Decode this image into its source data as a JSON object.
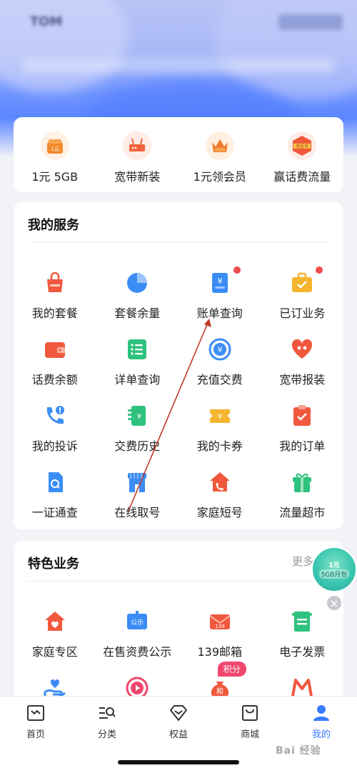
{
  "hero": {
    "title": "TOM"
  },
  "promo": [
    {
      "label": "1元 5GB",
      "icon": "gift-box-icon",
      "icon_text": "1元",
      "color": "#f28a2d",
      "bg": "#fff1e3"
    },
    {
      "label": "宽带新装",
      "icon": "router-icon",
      "icon_text": "",
      "color": "#f0633a",
      "bg": "#ffece4"
    },
    {
      "label": "1元领会员",
      "icon": "crown-icon",
      "icon_text": "特惠",
      "color": "#f27b2e",
      "bg": "#fff0e2"
    },
    {
      "label": "赢话费流量",
      "icon": "gold-badge-icon",
      "icon_text": "领金币",
      "color": "#f05a3a",
      "bg": "#ffece6"
    }
  ],
  "my_services": {
    "title": "我的服务",
    "items": [
      {
        "label": "我的套餐",
        "icon": "bag-icon",
        "color": "#f0593e",
        "dot": false
      },
      {
        "label": "套餐余量",
        "icon": "pie-chart-icon",
        "color": "#3b8df5",
        "dot": false
      },
      {
        "label": "账单查询",
        "icon": "bill-icon",
        "color": "#3b8df5",
        "dot": true
      },
      {
        "label": "已订业务",
        "icon": "briefcase-icon",
        "color": "#f5b52e",
        "dot": true
      },
      {
        "label": "话费余额",
        "icon": "wallet-icon",
        "color": "#f0593e",
        "dot": false
      },
      {
        "label": "详单查询",
        "icon": "list-icon",
        "color": "#2ec27e",
        "dot": false
      },
      {
        "label": "充值交费",
        "icon": "yuan-circle-icon",
        "color": "#3b8df5",
        "dot": false
      },
      {
        "label": "宽带报装",
        "icon": "heart-people-icon",
        "color": "#f0593e",
        "dot": false
      },
      {
        "label": "我的投诉",
        "icon": "phone-alert-icon",
        "color": "#3b8df5",
        "dot": false
      },
      {
        "label": "交费历史",
        "icon": "receipt-icon",
        "color": "#2ec27e",
        "dot": false
      },
      {
        "label": "我的卡券",
        "icon": "ticket-icon",
        "color": "#f5b52e",
        "dot": false
      },
      {
        "label": "我的订单",
        "icon": "clipboard-check-icon",
        "color": "#f0593e",
        "dot": false
      },
      {
        "label": "一证通查",
        "icon": "sim-card-icon",
        "color": "#3b8df5",
        "dot": false
      },
      {
        "label": "在线取号",
        "icon": "store-icon",
        "color": "#3b8df5",
        "dot": false
      },
      {
        "label": "家庭短号",
        "icon": "house-phone-icon",
        "color": "#f0593e",
        "dot": false
      },
      {
        "label": "流量超市",
        "icon": "gift-icon",
        "color": "#2ec27e",
        "dot": false
      }
    ]
  },
  "features": {
    "title": "特色业务",
    "more": "更多",
    "items": [
      {
        "label": "家庭专区",
        "icon": "home-heart-icon",
        "color": "#f0593e"
      },
      {
        "label": "在售资费公示",
        "icon": "notice-icon",
        "color": "#3b8df5",
        "icon_text": "公示"
      },
      {
        "label": "139邮箱",
        "icon": "mail-icon",
        "color": "#f0593e",
        "icon_text": "139"
      },
      {
        "label": "电子发票",
        "icon": "invoice-icon",
        "color": "#2ec27e"
      },
      {
        "label": "",
        "icon": "hand-heart-icon",
        "color": "#3b8df5"
      },
      {
        "label": "",
        "icon": "play-headset-icon",
        "color": "#f0476e"
      },
      {
        "label": "",
        "icon": "money-bag-icon",
        "color": "#f0593e",
        "icon_text": "和",
        "badge": "积分"
      },
      {
        "label": "",
        "icon": "m-logo-icon",
        "color": "#f0593e"
      }
    ]
  },
  "float_promo": {
    "line1": "1元",
    "line2": "5GB月包"
  },
  "tabbar": [
    {
      "label": "首页",
      "icon": "home-tab-icon",
      "active": false
    },
    {
      "label": "分类",
      "icon": "category-search-icon",
      "active": false
    },
    {
      "label": "权益",
      "icon": "diamond-icon",
      "active": false
    },
    {
      "label": "商城",
      "icon": "shopping-bag-icon",
      "active": false
    },
    {
      "label": "我的",
      "icon": "user-icon",
      "active": true
    }
  ],
  "watermark": "Bai 经验",
  "colors": {
    "accent": "#3a7bff",
    "red_dot": "#f04a4a",
    "badge": "#f0476e"
  }
}
